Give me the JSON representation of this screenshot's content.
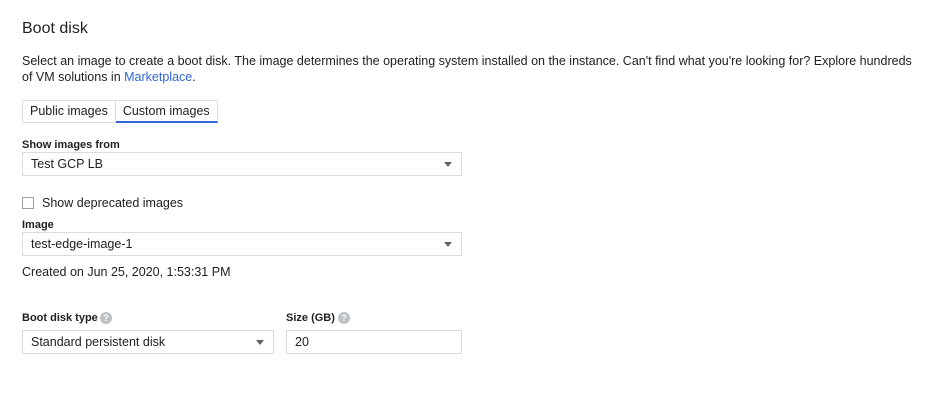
{
  "section": {
    "title": "Boot disk",
    "description": "Select an image to create a boot disk. The image determines the operating system installed on the instance. Can't find what you're looking for? Explore hundreds of VM solutions in ",
    "marketplace_link": "Marketplace",
    "description_end": "."
  },
  "tabs": [
    {
      "label": "Public images",
      "active": false
    },
    {
      "label": "Custom images",
      "active": true
    }
  ],
  "show_images_from": {
    "label": "Show images from",
    "value": "Test GCP LB"
  },
  "deprecated_checkbox": {
    "label": "Show deprecated images",
    "checked": false
  },
  "image": {
    "label": "Image",
    "value": "test-edge-image-1",
    "created": "Created on Jun 25, 2020, 1:53:31 PM"
  },
  "boot_disk_type": {
    "label": "Boot disk type",
    "value": "Standard persistent disk",
    "help_icon": "help-icon"
  },
  "size": {
    "label": "Size (GB)",
    "value": "20",
    "help_icon": "help-icon"
  },
  "colors": {
    "accent": "#3367d6",
    "border": "#dadce0",
    "text": "#202124"
  }
}
